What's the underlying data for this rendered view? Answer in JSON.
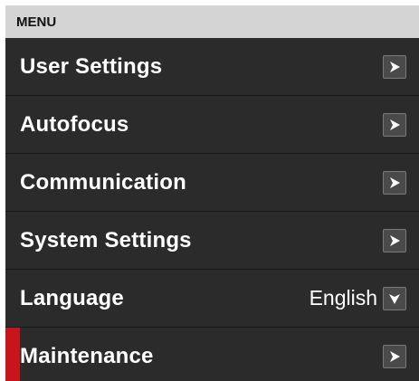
{
  "menu": {
    "title": "MENU",
    "accent_color": "#c8141b",
    "items": [
      {
        "label": "User Settings",
        "icon": "chevron-right-icon"
      },
      {
        "label": "Autofocus",
        "icon": "chevron-right-icon"
      },
      {
        "label": "Communication",
        "icon": "chevron-right-icon"
      },
      {
        "label": "System Settings",
        "icon": "chevron-right-icon"
      },
      {
        "label": "Language",
        "value": "English",
        "icon": "chevron-down-icon"
      },
      {
        "label": "Maintenance",
        "icon": "chevron-right-icon",
        "selected": true
      }
    ]
  }
}
